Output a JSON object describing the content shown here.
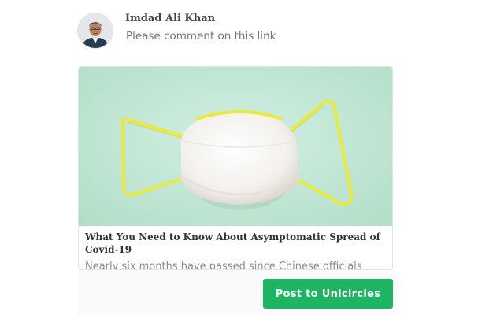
{
  "post": {
    "author_name": "Imdad Ali Khan",
    "comment": "Please comment on this link"
  },
  "link_preview": {
    "title": "What You Need to Know About Asymptomatic Spread of Covid-19",
    "description": "Nearly six months have passed since Chinese officials",
    "image_subject": "face-mask-image"
  },
  "actions": {
    "post_label": "Post to Unicircles"
  },
  "colors": {
    "accent": "#1db462",
    "image_background": "#bfe6d3",
    "strap": "#e9ea3c"
  }
}
